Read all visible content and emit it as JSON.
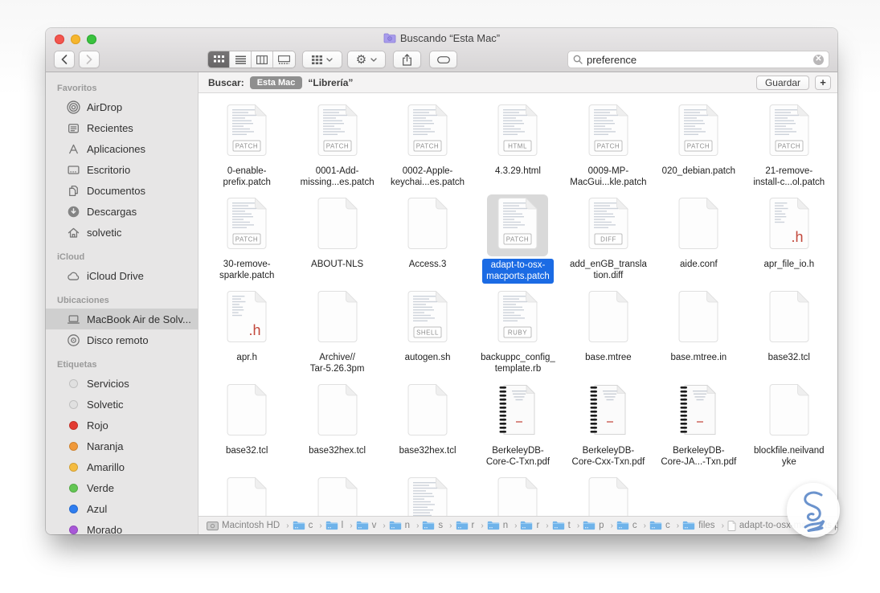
{
  "window": {
    "title": "Buscando “Esta Mac”",
    "title_icon": "smart-folder",
    "traffic_lights": [
      "close",
      "minimize",
      "zoom"
    ]
  },
  "toolbar": {
    "views": [
      {
        "id": "icons",
        "selected": true
      },
      {
        "id": "list",
        "selected": false
      },
      {
        "id": "columns",
        "selected": false
      },
      {
        "id": "coverflow",
        "selected": false
      }
    ],
    "group_menu_icon": "grouping",
    "action_menu_icon": "gear",
    "share_icon": "share",
    "tag_icon": "tag",
    "search": {
      "value": "preference",
      "icon": "magnifier",
      "clear_icon": "clear-x"
    }
  },
  "scope_bar": {
    "label": "Buscar:",
    "scopes": [
      {
        "label": "Esta Mac",
        "selected": true
      },
      {
        "label": "“Librería”",
        "selected": false
      }
    ],
    "save_label": "Guardar",
    "add_label": "+"
  },
  "sidebar": {
    "sections": [
      {
        "title": "Favoritos",
        "items": [
          {
            "id": "airdrop",
            "label": "AirDrop",
            "icon": "airdrop"
          },
          {
            "id": "recientes",
            "label": "Recientes",
            "icon": "recents"
          },
          {
            "id": "aplicaciones",
            "label": "Aplicaciones",
            "icon": "apps"
          },
          {
            "id": "escritorio",
            "label": "Escritorio",
            "icon": "desktop"
          },
          {
            "id": "documentos",
            "label": "Documentos",
            "icon": "docs"
          },
          {
            "id": "descargas",
            "label": "Descargas",
            "icon": "downloads"
          },
          {
            "id": "solvetic",
            "label": "solvetic",
            "icon": "home"
          }
        ]
      },
      {
        "title": "iCloud",
        "items": [
          {
            "id": "icloud-drive",
            "label": "iCloud Drive",
            "icon": "cloud"
          }
        ]
      },
      {
        "title": "Ubicaciones",
        "items": [
          {
            "id": "macbook-air",
            "label": "MacBook Air de Solv...",
            "icon": "laptop",
            "selected": true
          },
          {
            "id": "disco-remoto",
            "label": "Disco remoto",
            "icon": "disc"
          }
        ]
      },
      {
        "title": "Etiquetas",
        "items": [
          {
            "id": "tag-servicios",
            "label": "Servicios",
            "color": "#e0e0e0"
          },
          {
            "id": "tag-solvetic",
            "label": "Solvetic",
            "color": "#e0e0e0"
          },
          {
            "id": "tag-rojo",
            "label": "Rojo",
            "color": "#e23b32"
          },
          {
            "id": "tag-naranja",
            "label": "Naranja",
            "color": "#f0993a"
          },
          {
            "id": "tag-amarillo",
            "label": "Amarillo",
            "color": "#f5bc41"
          },
          {
            "id": "tag-verde",
            "label": "Verde",
            "color": "#63c653"
          },
          {
            "id": "tag-azul",
            "label": "Azul",
            "color": "#2e7df0"
          },
          {
            "id": "tag-morado",
            "label": "Morado",
            "color": "#a857d8"
          }
        ]
      }
    ]
  },
  "files": {
    "items": [
      {
        "name": "0-enable-\nprefix.patch",
        "type": "patch",
        "badge": "PATCH"
      },
      {
        "name": "0001-Add-\nmissing...es.patch",
        "type": "patch",
        "badge": "PATCH"
      },
      {
        "name": "0002-Apple-\nkeychai...es.patch",
        "type": "patch",
        "badge": "PATCH"
      },
      {
        "name": "4.3.29.html",
        "type": "html",
        "badge": "HTML"
      },
      {
        "name": "0009-MP-\nMacGui...kle.patch",
        "type": "patch",
        "badge": "PATCH"
      },
      {
        "name": "020_debian.patch",
        "type": "patch",
        "badge": "PATCH"
      },
      {
        "name": "21-remove-\ninstall-c...ol.patch",
        "type": "patch",
        "badge": "PATCH"
      },
      {
        "name": "30-remove-\nsparkle.patch",
        "type": "patch",
        "badge": "PATCH"
      },
      {
        "name": "ABOUT-NLS",
        "type": "blank"
      },
      {
        "name": "Access.3",
        "type": "blank"
      },
      {
        "name": "adapt-to-osx-\nmacports.patch",
        "type": "patch",
        "badge": "PATCH",
        "selected": true
      },
      {
        "name": "add_enGB_transla\ntion.diff",
        "type": "diff",
        "badge": "DIFF"
      },
      {
        "name": "aide.conf",
        "type": "blank"
      },
      {
        "name": "apr_file_io.h",
        "type": "h"
      },
      {
        "name": "apr.h",
        "type": "h"
      },
      {
        "name": "Archive//\nTar-5.26.3pm",
        "type": "blank"
      },
      {
        "name": "autogen.sh",
        "type": "shell",
        "badge": "SHELL"
      },
      {
        "name": "backuppc_config_\ntemplate.rb",
        "type": "ruby",
        "badge": "RUBY"
      },
      {
        "name": "base.mtree",
        "type": "blank"
      },
      {
        "name": "base.mtree.in",
        "type": "blank"
      },
      {
        "name": "base32.tcl",
        "type": "blank"
      },
      {
        "name": "base32.tcl",
        "type": "blank"
      },
      {
        "name": "base32hex.tcl",
        "type": "blank"
      },
      {
        "name": "base32hex.tcl",
        "type": "blank"
      },
      {
        "name": "BerkeleyDB-\nCore-C-Txn.pdf",
        "type": "pdfbook"
      },
      {
        "name": "BerkeleyDB-\nCore-Cxx-Txn.pdf",
        "type": "pdfbook"
      },
      {
        "name": "BerkeleyDB-\nCore-JA...-Txn.pdf",
        "type": "pdfbook"
      },
      {
        "name": "blockfile.neilvand\nyke",
        "type": "blank"
      }
    ],
    "partial_row": [
      {
        "type": "blank"
      },
      {
        "type": "blank"
      },
      {
        "type": "text"
      },
      {
        "type": "blank"
      },
      {
        "type": "blank"
      }
    ]
  },
  "path_bar": {
    "items": [
      {
        "type": "disk",
        "label": "Macintosh HD"
      },
      {
        "type": "folder",
        "label": "c"
      },
      {
        "type": "folder",
        "label": "l"
      },
      {
        "type": "folder",
        "label": "v"
      },
      {
        "type": "folder",
        "label": "n"
      },
      {
        "type": "folder",
        "label": "s"
      },
      {
        "type": "folder",
        "label": "r"
      },
      {
        "type": "folder",
        "label": "n"
      },
      {
        "type": "folder",
        "label": "r"
      },
      {
        "type": "folder",
        "label": "t"
      },
      {
        "type": "folder",
        "label": "p"
      },
      {
        "type": "folder",
        "label": "c"
      },
      {
        "type": "folder",
        "label": "c"
      },
      {
        "type": "folder",
        "label": "files"
      },
      {
        "type": "file",
        "label": "adapt-to-osx-macports.patch"
      }
    ]
  },
  "watermark": {
    "name": "solvetic-logo"
  },
  "colors": {
    "selection_blue": "#1b6be4",
    "icon_selection_gray": "#d9d9d9",
    "scope_pill_gray": "#8f8f8f",
    "tag_red": "#e23b32",
    "tag_orange": "#f0993a",
    "tag_yellow": "#f5bc41",
    "tag_green": "#63c653",
    "tag_blue": "#2e7df0",
    "tag_purple": "#a857d8"
  }
}
